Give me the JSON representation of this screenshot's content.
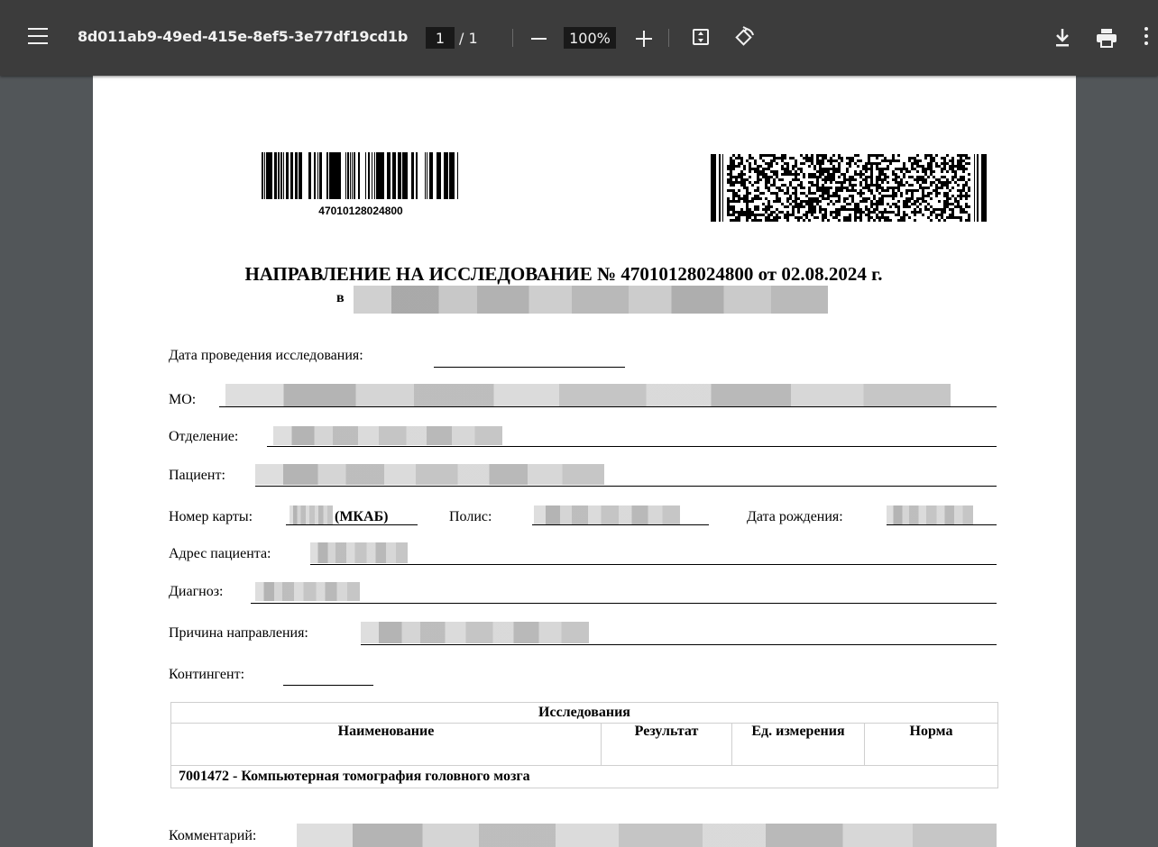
{
  "toolbar": {
    "document_title": "8d011ab9-49ed-415e-8ef5-3e77df19cd1b",
    "page_current": "1",
    "page_total": "/ 1",
    "zoom": "100%"
  },
  "document": {
    "barcode_number": "47010128024800",
    "heading": "НАПРАВЛЕНИЕ НА ИССЛЕДОВАНИЕ № 47010128024800 от 02.08.2024 г.",
    "heading_in": "в",
    "fields": {
      "study_date": "Дата проведения исследования:",
      "mo": "МО:",
      "department": "Отделение:",
      "patient": "Пациент:",
      "card_number": "Номер карты:",
      "card_type": "(МКАБ)",
      "policy": "Полис:",
      "birth_date": "Дата рождения:",
      "address": "Адрес пациента:",
      "diagnosis": "Диагноз:",
      "reason": "Причина направления:",
      "contingent": "Контингент:"
    },
    "table": {
      "caption": "Исследования",
      "headers": [
        "Наименование",
        "Результат",
        "Ед. измерения",
        "Норма"
      ],
      "rows": [
        {
          "name": "7001472 - Компьютерная томография головного мозга",
          "result": "",
          "unit": "",
          "norm": ""
        }
      ]
    },
    "comment_label": "Комментарий:"
  },
  "colors": {
    "toolbar_bg": "#3c3c3c",
    "viewer_bg": "#525659",
    "page_bg": "#ffffff"
  }
}
